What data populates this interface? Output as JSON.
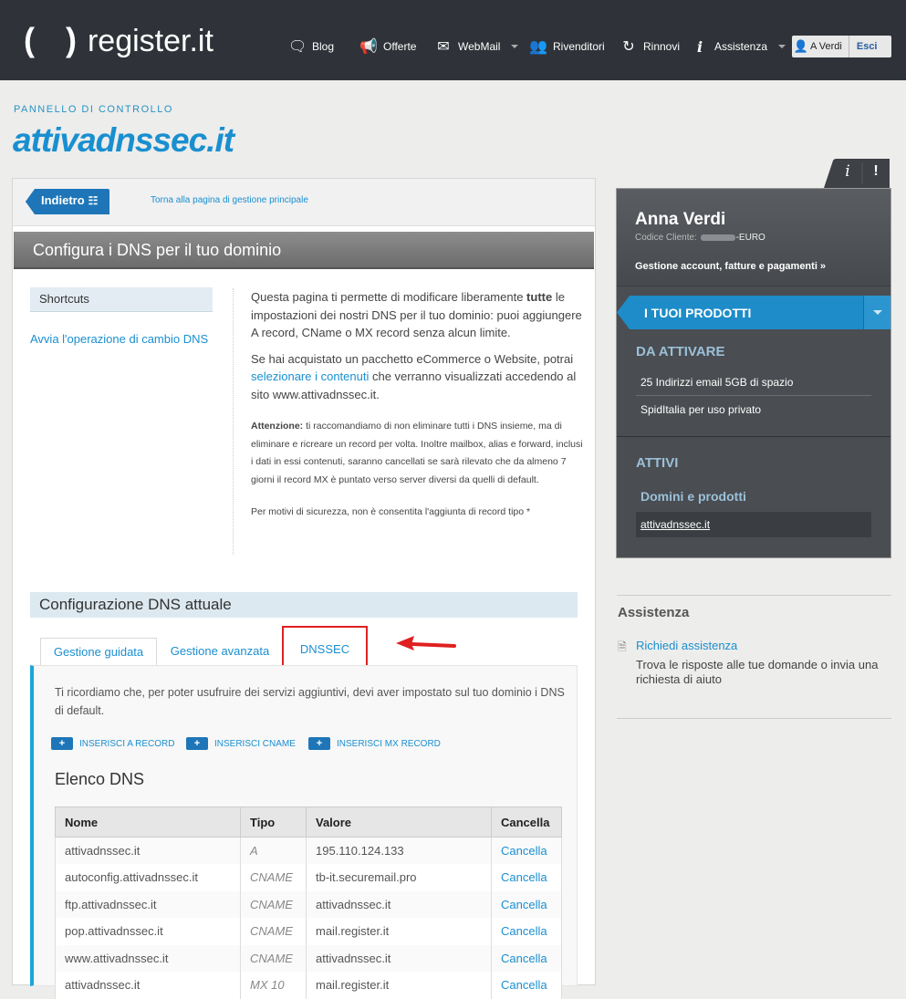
{
  "header": {
    "logo_paren": "( )",
    "logo_text": "register.it",
    "nav": [
      {
        "label": "Blog",
        "icon": "chat-bubbles-icon"
      },
      {
        "label": "Offerte",
        "icon": "megaphone-icon"
      },
      {
        "label": "WebMail",
        "icon": "envelope-icon"
      },
      {
        "label": "Rivenditori",
        "icon": "people-icon"
      },
      {
        "label": "Rinnovi",
        "icon": "refresh-icon"
      },
      {
        "label": "Assistenza",
        "icon": "info-icon"
      }
    ],
    "user_label": "A Verdi",
    "logout_label": "Esci"
  },
  "page": {
    "kicker": "PANNELLO DI CONTROLLO",
    "domain": "attivadnssec.it"
  },
  "main": {
    "back_label": "Indietro",
    "back_link": "Torna alla pagina di gestione principale",
    "section_title": "Configura i DNS per il tuo dominio",
    "shortcuts_label": "Shortcuts",
    "shortcut_link": "Avvia l'operazione di cambio DNS",
    "intro": {
      "p1_a": "Questa pagina ti permette di modificare liberamente ",
      "p1_b": "tutte",
      "p1_c": " le impostazioni dei nostri DNS per il tuo dominio: puoi aggiungere A record, CName o MX record senza alcun limite.",
      "p2_a": "Se hai acquistato un pacchetto eCommerce o Website, potrai ",
      "p2_link": "selezionare i contenuti",
      "p2_b": " che verranno visualizzati accedendo al sito www.attivadnssec.it.",
      "warn_label": "Attenzione:",
      "warn_text": " ti raccomandiamo di non eliminare tutti i DNS insieme, ma di eliminare e ricreare un record per volta. Inoltre mailbox, alias e forward, inclusi i dati in essi contenuti, saranno cancellati se sarà rilevato che da almeno 7 giorni il record MX è puntato verso server diversi da quelli di default.",
      "security_note": "Per motivi di sicurezza, non è consentita l'aggiunta di record tipo *"
    },
    "config_title": "Configurazione DNS attuale",
    "tabs": [
      "Gestione guidata",
      "Gestione avanzata",
      "DNSSEC"
    ],
    "panel_note": "Ti ricordiamo che, per poter usufruire dei servizi aggiuntivi, devi aver impostato sul tuo dominio i DNS di default.",
    "add_buttons": [
      "INSERISCI A RECORD",
      "INSERISCI CNAME",
      "INSERISCI MX RECORD"
    ],
    "add_plus": "+",
    "dns_list_title": "Elenco DNS",
    "dns_table": {
      "headers": [
        "Nome",
        "Tipo",
        "Valore",
        "Cancella"
      ],
      "rows": [
        [
          "attivadnssec.it",
          "A",
          "195.110.124.133",
          "Cancella"
        ],
        [
          "autoconfig.attivadnssec.it",
          "CNAME",
          "tb-it.securemail.pro",
          "Cancella"
        ],
        [
          "ftp.attivadnssec.it",
          "CNAME",
          "attivadnssec.it",
          "Cancella"
        ],
        [
          "pop.attivadnssec.it",
          "CNAME",
          "mail.register.it",
          "Cancella"
        ],
        [
          "www.attivadnssec.it",
          "CNAME",
          "attivadnssec.it",
          "Cancella"
        ],
        [
          "attivadnssec.it",
          "MX 10",
          "mail.register.it",
          "Cancella"
        ]
      ]
    }
  },
  "sidebar": {
    "info_tab": "i",
    "alert_tab": "!",
    "name": "Anna Verdi",
    "code_label": "Codice Cliente:",
    "code_suffix": "-EURO",
    "account_link": "Gestione account, fatture e pagamenti »",
    "products_title": "I TUOI PRODOTTI",
    "to_activate_title": "DA ATTIVARE",
    "to_activate_items": [
      "25 Indirizzi email 5GB di spazio",
      "SpidItalia per uso privato"
    ],
    "active_title": "ATTIVI",
    "domains_title": "Domini e prodotti",
    "domain_item": "attivadnssec.it"
  },
  "assistance": {
    "title": "Assistenza",
    "link": "Richiedi assistenza",
    "text": "Trova le risposte alle tue domande o invia una richiesta di aiuto"
  },
  "colors": {
    "accent": "#1a8fd0",
    "topbar": "#2f3339",
    "highlight_box": "#e02020"
  }
}
